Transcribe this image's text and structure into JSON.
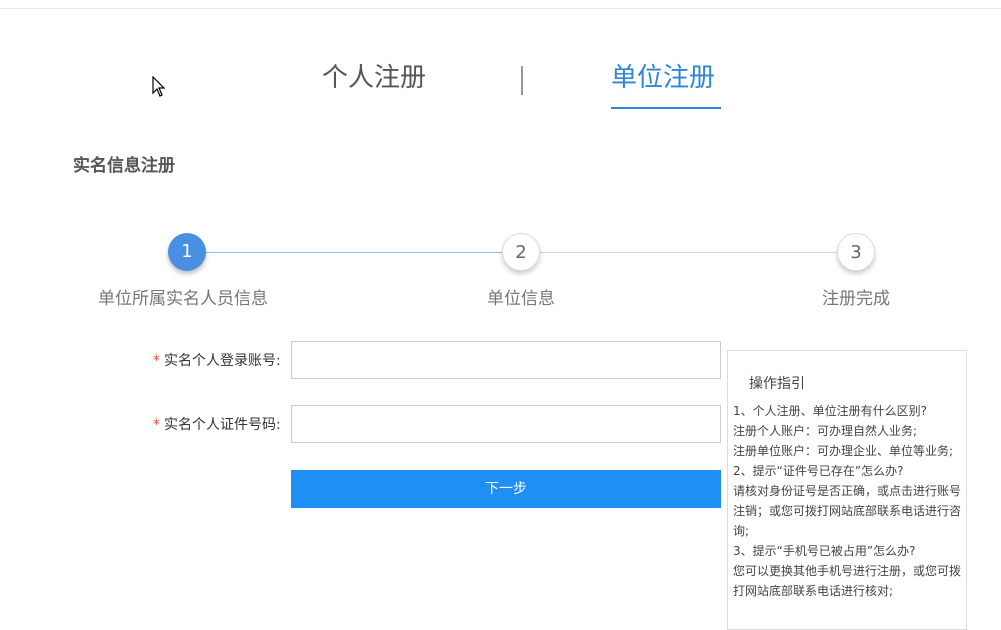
{
  "tabs": {
    "personal": "个人注册",
    "unit": "单位注册"
  },
  "section_title": "实名信息注册",
  "steps": [
    {
      "number": "1",
      "label": "单位所属实名人员信息",
      "state": "active"
    },
    {
      "number": "2",
      "label": "单位信息",
      "state": "inactive"
    },
    {
      "number": "3",
      "label": "注册完成",
      "state": "inactive"
    }
  ],
  "form": {
    "required_mark": "*",
    "account_label": "实名个人登录账号:",
    "account_value": "",
    "id_label": "实名个人证件号码:",
    "id_value": "",
    "next_button": "下一步"
  },
  "guide": {
    "title": "操作指引",
    "lines": [
      "1、个人注册、单位注册有什么区别?",
      "注册个人账户：可办理自然人业务;",
      "注册单位账户：可办理企业、单位等业务;",
      "2、提示“证件号已存在”怎么办?",
      "请核对身份证号是否正确，或点击进行账号注销；或您可拨打网站底部联系电话进行咨询;",
      "3、提示“手机号已被占用”怎么办?",
      "您可以更换其他手机号进行注册，或您可拨打网站底部联系电话进行核对;"
    ]
  },
  "colors": {
    "accent": "#2e86d8",
    "button": "#1e90f5",
    "required": "#e74c3c"
  }
}
